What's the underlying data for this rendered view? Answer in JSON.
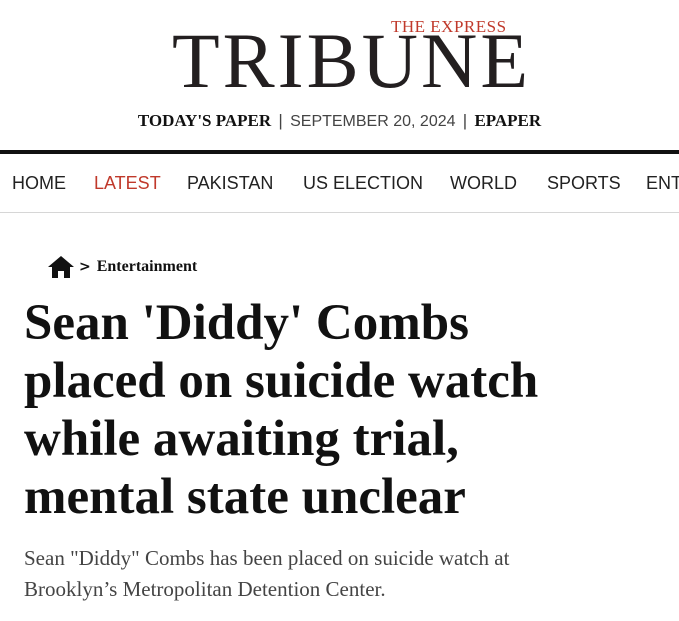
{
  "masthead": {
    "kicker": "THE EXPRESS",
    "logo": "TRIBUNE",
    "todays_paper": "TODAY'S PAPER",
    "separator": "|",
    "date": "SEPTEMBER 20, 2024",
    "epaper": "EPAPER"
  },
  "nav": {
    "items": [
      {
        "label": "HOME"
      },
      {
        "label": "LATEST"
      },
      {
        "label": "PAKISTAN"
      },
      {
        "label": "US ELECTION"
      },
      {
        "label": "WORLD"
      },
      {
        "label": "SPORTS"
      },
      {
        "label": "ENT"
      }
    ],
    "active": "LATEST"
  },
  "breadcrumb": {
    "home_icon": "home-icon",
    "chevron": ">",
    "section": "Entertainment"
  },
  "article": {
    "headline_lines": [
      "Sean 'Diddy' Combs",
      "placed on suicide watch",
      "while awaiting trial,",
      "mental state unclear"
    ],
    "summary_lines": [
      "Sean \"Diddy\" Combs has been placed on suicide watch at",
      "Brooklyn’s Metropolitan Detention Center."
    ]
  },
  "colors": {
    "accent": "#c0392b",
    "text": "#111111",
    "muted": "#444444"
  }
}
